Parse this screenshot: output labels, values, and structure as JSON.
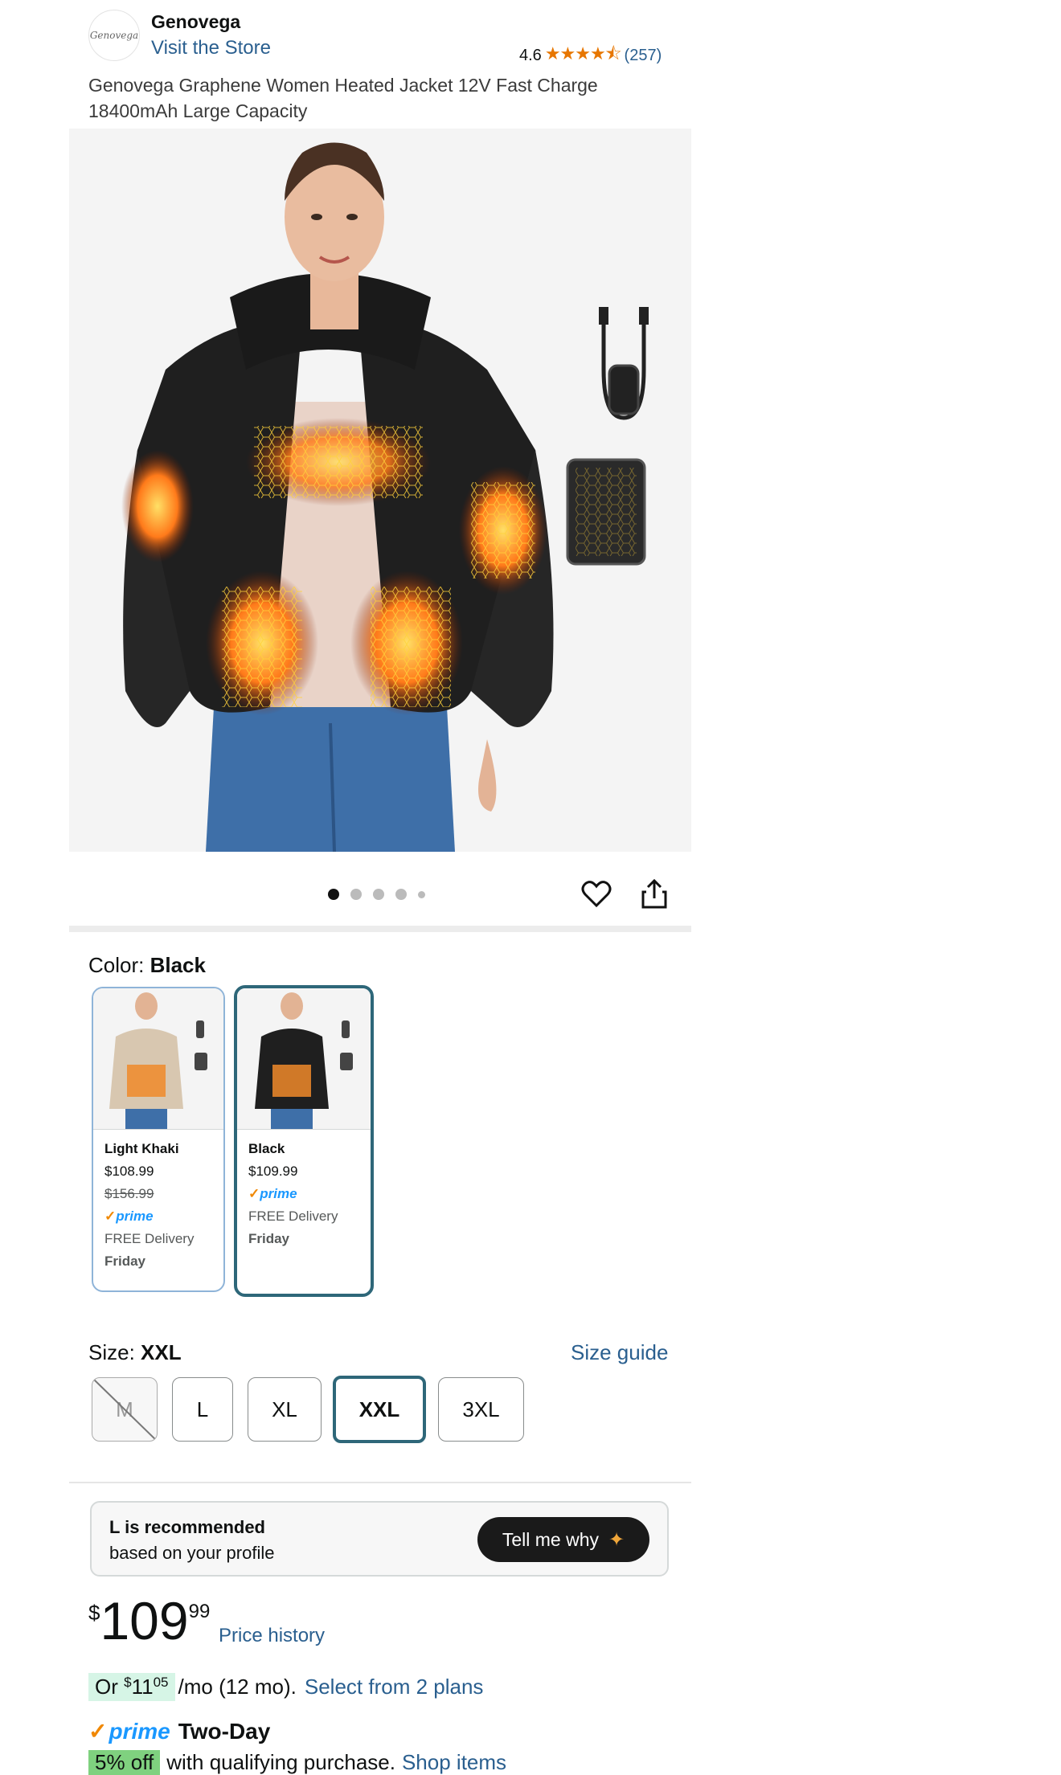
{
  "store": {
    "logo_text": "Genovega",
    "brand": "Genovega",
    "visit_link": "Visit the Store",
    "rating": "4.6",
    "stars": 4.6,
    "review_count": "(257)"
  },
  "product": {
    "title": "Genovega Graphene Women Heated Jacket 12V Fast Charge 18400mAh Large Capacity"
  },
  "gallery": {
    "image_count": 5,
    "active_index": 0
  },
  "color": {
    "label": "Color:",
    "selected": "Black",
    "options": [
      {
        "name": "Light Khaki",
        "price": "$108.99",
        "list_price": "$156.99",
        "prime": "prime",
        "delivery": "FREE Delivery",
        "day": "Friday"
      },
      {
        "name": "Black",
        "price": "$109.99",
        "prime": "prime",
        "delivery": "FREE Delivery",
        "day": "Friday"
      }
    ]
  },
  "size": {
    "label": "Size:",
    "selected": "XXL",
    "guide": "Size guide",
    "options": [
      "M",
      "L",
      "XL",
      "XXL",
      "3XL"
    ]
  },
  "recommendation": {
    "line1": "L is recommended",
    "line2": "based on your profile",
    "button": "Tell me why"
  },
  "price": {
    "symbol": "$",
    "whole": "109",
    "fraction": "99",
    "history_link": "Price history",
    "monthly_prefix": "Or ",
    "monthly_symbol": "$",
    "monthly_whole": "11",
    "monthly_fraction": "05",
    "monthly_suffix": "/mo (12 mo).",
    "plans_link": "Select from 2 plans"
  },
  "shipping": {
    "prime": "prime",
    "speed": "Two-Day",
    "offer_badge": "5% off",
    "offer_text": "with qualifying purchase.",
    "offer_link": "Shop items"
  },
  "colors": {
    "link": "#2a5f8f",
    "selected_border": "#2e6779",
    "prime_blue": "#1a98ff",
    "star": "#e77600"
  }
}
